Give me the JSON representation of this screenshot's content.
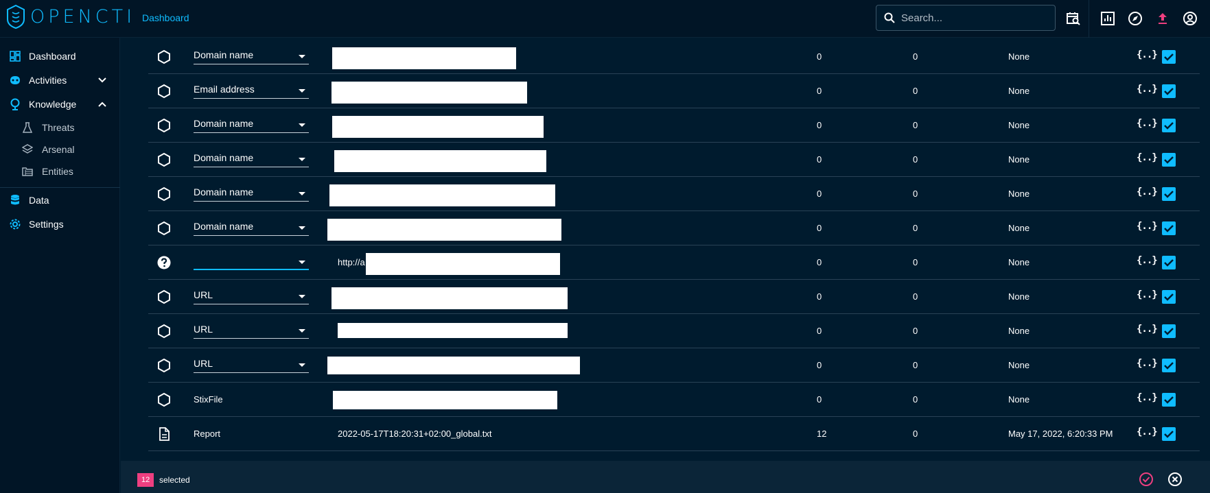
{
  "app": {
    "logo_text": "OPENCTI",
    "breadcrumb": "Dashboard"
  },
  "search": {
    "placeholder": "Search..."
  },
  "sidebar": {
    "items": [
      {
        "label": "Dashboard",
        "icon": "dashboard-icon"
      },
      {
        "label": "Activities",
        "icon": "activities-icon",
        "expanded": false
      },
      {
        "label": "Knowledge",
        "icon": "knowledge-icon",
        "expanded": true
      },
      {
        "label": "Threats",
        "icon": "flask-icon"
      },
      {
        "label": "Arsenal",
        "icon": "layers-icon"
      },
      {
        "label": "Entities",
        "icon": "folder-table-icon"
      },
      {
        "label": "Data",
        "icon": "database-icon"
      },
      {
        "label": "Settings",
        "icon": "gear-icon"
      }
    ]
  },
  "table": {
    "rows": [
      {
        "icon": "hexagon-icon",
        "type": "Domain name",
        "num1": "0",
        "num2": "0",
        "status": "None"
      },
      {
        "icon": "hexagon-icon",
        "type": "Email address",
        "num1": "0",
        "num2": "0",
        "status": "None"
      },
      {
        "icon": "hexagon-icon",
        "type": "Domain name",
        "num1": "0",
        "num2": "0",
        "status": "None"
      },
      {
        "icon": "hexagon-icon",
        "type": "Domain name",
        "num1": "0",
        "num2": "0",
        "status": "None"
      },
      {
        "icon": "hexagon-icon",
        "type": "Domain name",
        "num1": "0",
        "num2": "0",
        "status": "None"
      },
      {
        "icon": "hexagon-icon",
        "type": "Domain name",
        "num1": "0",
        "num2": "0",
        "status": "None"
      },
      {
        "icon": "question-icon",
        "type": "",
        "value_prefix": "http://a",
        "num1": "0",
        "num2": "0",
        "status": "None"
      },
      {
        "icon": "hexagon-icon",
        "type": "URL",
        "num1": "0",
        "num2": "0",
        "status": "None"
      },
      {
        "icon": "hexagon-icon",
        "type": "URL",
        "num1": "0",
        "num2": "0",
        "status": "None"
      },
      {
        "icon": "hexagon-icon",
        "type": "URL",
        "num1": "0",
        "num2": "0",
        "status": "None"
      },
      {
        "icon": "hexagon-icon",
        "type_text": "StixFile",
        "num1": "0",
        "num2": "0",
        "status": "None"
      },
      {
        "icon": "file-icon",
        "type_text": "Report",
        "value": "2022-05-17T18:20:31+02:00_global.txt",
        "num1": "12",
        "num2": "0",
        "status": "May 17, 2022, 6:20:33 PM"
      }
    ],
    "json_label": "{..}"
  },
  "bottombar": {
    "count": "12",
    "selected_label": "selected"
  },
  "colors": {
    "accent": "#0fbcff",
    "pink": "#ee3f80",
    "background": "#001b2e"
  }
}
